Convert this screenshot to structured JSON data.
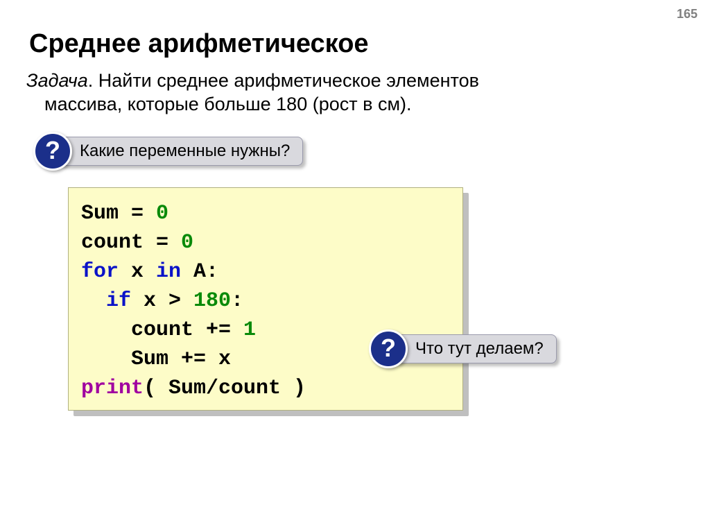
{
  "page_number": "165",
  "title": "Среднее арифметическое",
  "task": {
    "label": "Задача",
    "text_line1": ". Найти среднее арифметическое элементов",
    "text_line2": "массива, которые больше 180 (рост в см)."
  },
  "callouts": {
    "q_mark": "?",
    "c1": "Какие переменные нужны?",
    "c2": "Что тут делаем?"
  },
  "code": {
    "l1": {
      "a": "Sum = ",
      "b": "0"
    },
    "l2": {
      "a": "count = ",
      "b": "0"
    },
    "l3": {
      "a": "for",
      "b": " x ",
      "c": "in",
      "d": " A:"
    },
    "l4": {
      "a": "  ",
      "b": "if",
      "c": " x > ",
      "d": "180",
      "e": ":"
    },
    "l5": {
      "a": "    count += ",
      "b": "1"
    },
    "l6": {
      "a": "    Sum += x"
    },
    "l7": {
      "a": "print",
      "b": "( Sum/count )"
    }
  }
}
